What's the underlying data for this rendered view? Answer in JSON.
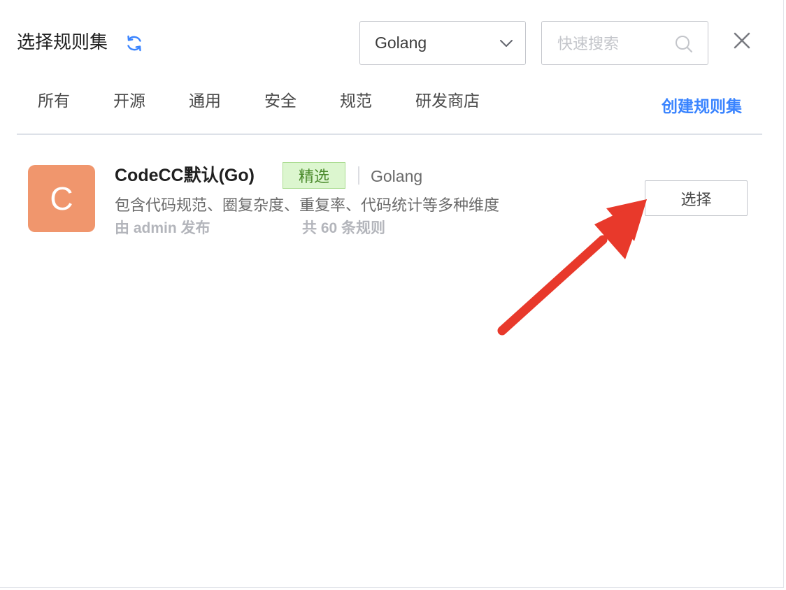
{
  "header": {
    "title": "选择规则集",
    "language_select": {
      "selected": "Golang"
    },
    "search": {
      "placeholder": "快速搜索",
      "value": ""
    }
  },
  "tabs": [
    {
      "label": "所有"
    },
    {
      "label": "开源"
    },
    {
      "label": "通用"
    },
    {
      "label": "安全"
    },
    {
      "label": "规范"
    },
    {
      "label": "研发商店"
    }
  ],
  "create_link": "创建规则集",
  "ruleset": {
    "avatar_letter": "C",
    "name": "CodeCC默认(Go)",
    "badge": "精选",
    "language": "Golang",
    "description": "包含代码规范、圈复杂度、重复率、代码统计等多种维度",
    "publisher": "由 admin 发布",
    "rule_count": "共 60 条规则",
    "select_label": "选择"
  },
  "colors": {
    "accent": "#3a84ff",
    "avatar_bg": "#f0966d",
    "badge_bg": "#dcf6cf",
    "badge_text": "#4b8a2c",
    "annotation_arrow": "#e8392b"
  },
  "icons": {
    "refresh": "refresh-icon",
    "dropdown": "chevron-down-icon",
    "search": "search-icon",
    "close": "close-icon",
    "annotation": "arrow-annotation"
  }
}
